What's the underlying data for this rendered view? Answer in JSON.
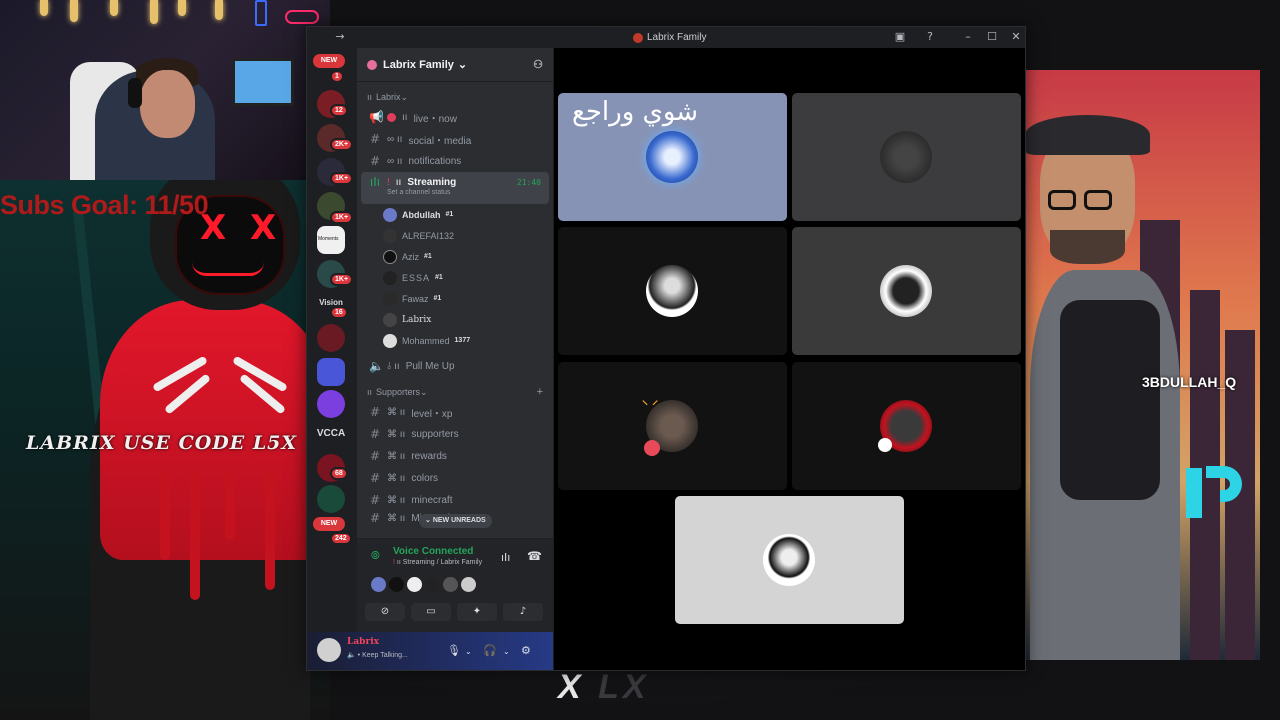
{
  "overlay": {
    "subs_goal": "Subs Goal: 11/50",
    "promo": "LABRIX USE CODE L5X",
    "abdullah_tag": "3BDULLAH_Q",
    "bottom_mark_x": "X",
    "bottom_mark_right": "LX",
    "smile": ":)"
  },
  "window": {
    "title": "Labrix Family"
  },
  "server_rail": {
    "badges": [
      "1",
      "12",
      "2K+",
      "1K+",
      "1K+",
      "1K+",
      "16",
      "68",
      "242"
    ],
    "new_label": "NEW",
    "text_icons": [
      "Vision",
      "VCCA"
    ],
    "moments": "Moments"
  },
  "server": {
    "name": "Labrix Family",
    "categories": [
      {
        "name": "Labrix"
      },
      {
        "name": "Supporters"
      }
    ],
    "channels_top": [
      {
        "name": "live・now",
        "icon": "megaphone"
      },
      {
        "name": "social・media",
        "icon": "hash"
      },
      {
        "name": "notifications",
        "icon": "hash"
      }
    ],
    "streaming_channel": {
      "name": "Streaming",
      "time": "21:40",
      "status": "Set a channel status"
    },
    "voice_users": [
      {
        "name": "Abdullah",
        "tag": "#1"
      },
      {
        "name": "ALREFAI132",
        "tag": ""
      },
      {
        "name": "Aziz",
        "tag": "#1"
      },
      {
        "name": "ESSA",
        "tag": "#1"
      },
      {
        "name": "Fawaz",
        "tag": "#1"
      },
      {
        "name": "Labrix",
        "tag": ""
      },
      {
        "name": "Mohammed",
        "tag": "1377"
      }
    ],
    "pull_channel": "Pull Me Up",
    "supporter_channels": [
      "level・xp",
      "supporters",
      "rewards",
      "colors",
      "minecraft",
      "Minecraft"
    ],
    "new_unreads": "NEW UNREADS"
  },
  "voice_panel": {
    "status": "Voice Connected",
    "location": "Streaming / Labrix Family"
  },
  "user_panel": {
    "name": "Labrix",
    "status": "Keep Talking..."
  },
  "stage": {
    "arabic_text": "شوي وراجع"
  },
  "colors": {
    "discord_bg": "#1e1f22",
    "channel_bg": "#2b2d31",
    "active_channel": "#404249",
    "connected_green": "#23a55a",
    "badge_red": "#da373c"
  }
}
